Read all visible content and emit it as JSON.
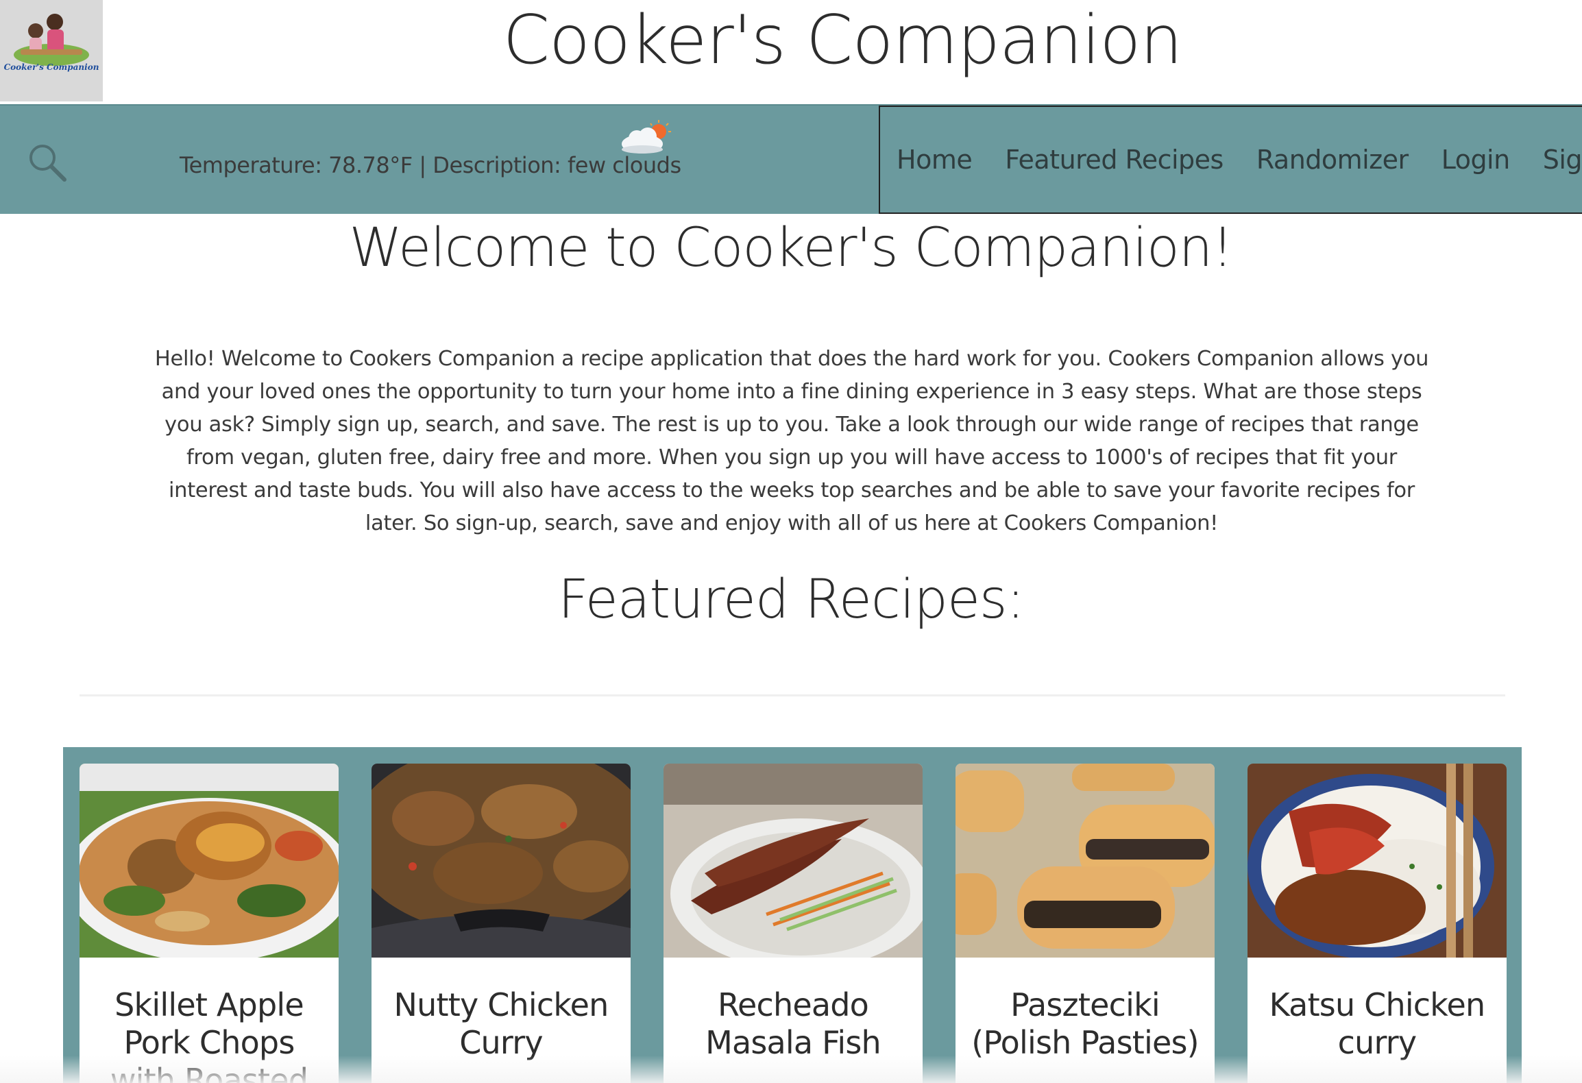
{
  "header": {
    "title": "Cooker's Companion",
    "logo_text": "Cooker's Companion"
  },
  "navbar": {
    "weather": "Temperature: 78.78°F | Description: few clouds",
    "links": [
      "Home",
      "Featured Recipes",
      "Randomizer",
      "Login",
      "Sign Up"
    ]
  },
  "main": {
    "welcome_heading": "Welcome to Cooker's Companion!",
    "welcome_text": "Hello! Welcome to Cookers Companion a recipe application that does the hard work for you. Cookers Companion allows you and your loved ones the opportunity to turn your home into a fine dining experience in 3 easy steps. What are those steps you ask? Simply sign up, search, and save. The rest is up to you. Take a look through our wide range of recipes that range from vegan, gluten free, dairy free and more. When you sign up you will have access to 1000's of recipes that fit your interest and taste buds. You will also have access to the weeks top searches and be able to save your favorite recipes for later. So sign-up, search, save and enjoy with all of us here at Cookers Companion!",
    "featured_heading": "Featured Recipes:"
  },
  "recipes": [
    {
      "title": "Skillet Apple Pork Chops with Roasted"
    },
    {
      "title": "Nutty Chicken Curry"
    },
    {
      "title": "Recheado Masala Fish"
    },
    {
      "title": "Paszteciki (Polish Pasties)"
    },
    {
      "title": "Katsu Chicken curry"
    }
  ],
  "colors": {
    "accent": "#6b9a9e",
    "text": "#2d2d2d"
  },
  "icons": [
    "search-icon",
    "weather-cloud-sun-icon",
    "logo-image"
  ]
}
